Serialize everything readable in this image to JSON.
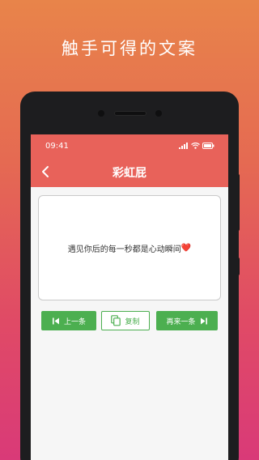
{
  "promo": {
    "title": "触手可得的文案"
  },
  "status_bar": {
    "time": "09:41"
  },
  "header": {
    "title": "彩虹屁"
  },
  "card": {
    "quote": "遇见你后的每一秒都是心动瞬间",
    "emoji": "❤️"
  },
  "buttons": {
    "prev": "上一条",
    "copy": "复制",
    "next": "再来一条"
  },
  "icons": {
    "back": "back-arrow-icon",
    "prev": "skip-previous-icon",
    "copy": "copy-icon",
    "next": "skip-next-icon",
    "signal": "signal-icon",
    "wifi": "wifi-icon",
    "battery": "battery-icon"
  },
  "colors": {
    "app_bar": "#e8625a",
    "button_green": "#4caf50",
    "heart": "#e53945"
  }
}
